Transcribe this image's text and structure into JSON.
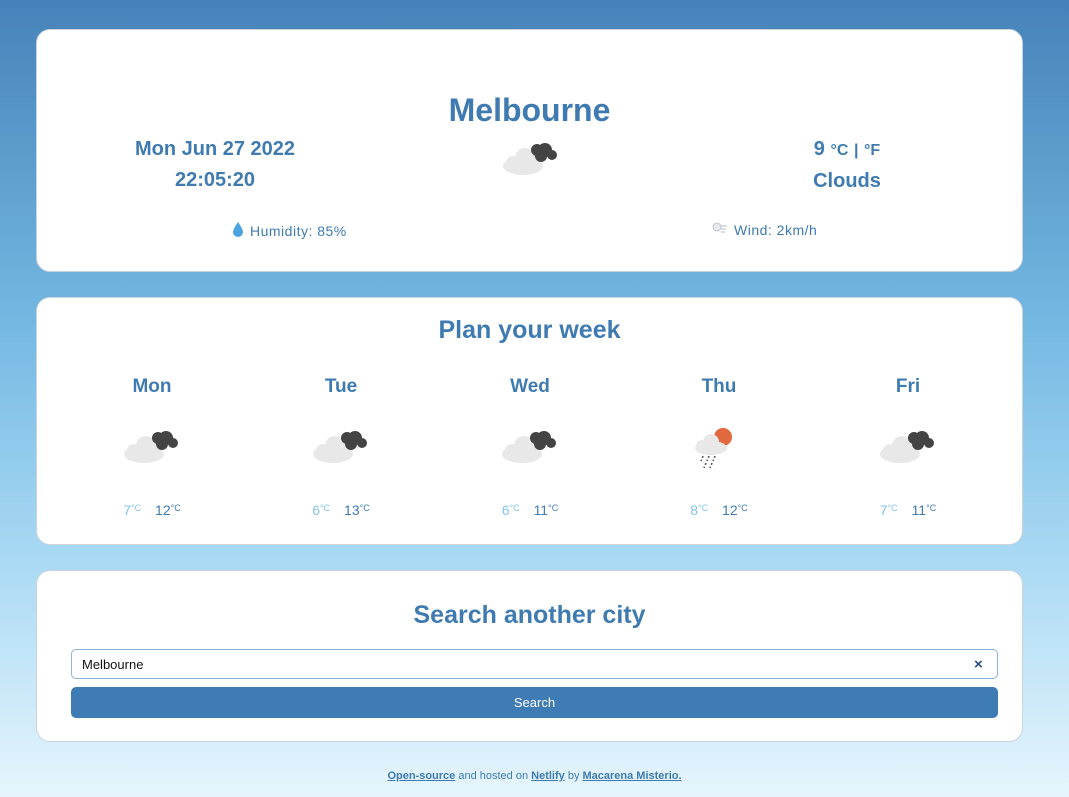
{
  "current": {
    "city": "Melbourne",
    "date": "Mon Jun 27 2022",
    "time": "22:05:20",
    "temperature": "9",
    "unit_c": "°C",
    "unit_sep": "|",
    "unit_f": "°F",
    "description": "Clouds",
    "icon": "broken-clouds-icon",
    "humidity_label": "Humidity: 85%",
    "wind_label": "Wind: 2km/h"
  },
  "week": {
    "title": "Plan your week",
    "unit": "°C",
    "days": [
      {
        "name": "Mon",
        "min": "7",
        "max": "12",
        "icon": "broken-clouds-icon"
      },
      {
        "name": "Tue",
        "min": "6",
        "max": "13",
        "icon": "broken-clouds-icon"
      },
      {
        "name": "Wed",
        "min": "6",
        "max": "11",
        "icon": "broken-clouds-icon"
      },
      {
        "name": "Thu",
        "min": "8",
        "max": "12",
        "icon": "rain-sun-icon"
      },
      {
        "name": "Fri",
        "min": "7",
        "max": "11",
        "icon": "broken-clouds-icon"
      }
    ]
  },
  "search": {
    "title": "Search another city",
    "value": "Melbourne",
    "clear_label": "×",
    "button_label": "Search"
  },
  "footer": {
    "open_source": "Open-source",
    "middle": " and hosted on ",
    "netlify": "Netlify",
    "by": " by ",
    "author": "Macarena Misterio."
  },
  "colors": {
    "accent": "#3f7bb0",
    "min_temp": "#84c4ea",
    "button": "#3f7bb5"
  }
}
